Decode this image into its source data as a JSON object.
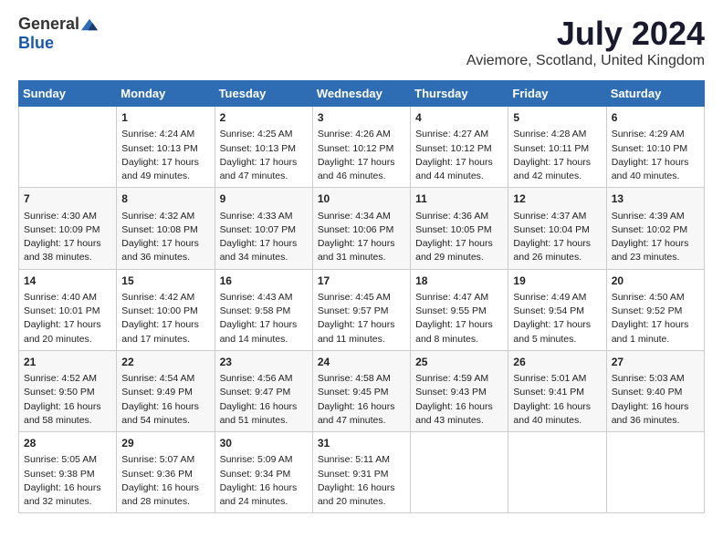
{
  "header": {
    "logo_general": "General",
    "logo_blue": "Blue",
    "month_title": "July 2024",
    "location": "Aviemore, Scotland, United Kingdom"
  },
  "weekdays": [
    "Sunday",
    "Monday",
    "Tuesday",
    "Wednesday",
    "Thursday",
    "Friday",
    "Saturday"
  ],
  "weeks": [
    [
      {
        "day": "",
        "content": ""
      },
      {
        "day": "1",
        "content": "Sunrise: 4:24 AM\nSunset: 10:13 PM\nDaylight: 17 hours\nand 49 minutes."
      },
      {
        "day": "2",
        "content": "Sunrise: 4:25 AM\nSunset: 10:13 PM\nDaylight: 17 hours\nand 47 minutes."
      },
      {
        "day": "3",
        "content": "Sunrise: 4:26 AM\nSunset: 10:12 PM\nDaylight: 17 hours\nand 46 minutes."
      },
      {
        "day": "4",
        "content": "Sunrise: 4:27 AM\nSunset: 10:12 PM\nDaylight: 17 hours\nand 44 minutes."
      },
      {
        "day": "5",
        "content": "Sunrise: 4:28 AM\nSunset: 10:11 PM\nDaylight: 17 hours\nand 42 minutes."
      },
      {
        "day": "6",
        "content": "Sunrise: 4:29 AM\nSunset: 10:10 PM\nDaylight: 17 hours\nand 40 minutes."
      }
    ],
    [
      {
        "day": "7",
        "content": "Sunrise: 4:30 AM\nSunset: 10:09 PM\nDaylight: 17 hours\nand 38 minutes."
      },
      {
        "day": "8",
        "content": "Sunrise: 4:32 AM\nSunset: 10:08 PM\nDaylight: 17 hours\nand 36 minutes."
      },
      {
        "day": "9",
        "content": "Sunrise: 4:33 AM\nSunset: 10:07 PM\nDaylight: 17 hours\nand 34 minutes."
      },
      {
        "day": "10",
        "content": "Sunrise: 4:34 AM\nSunset: 10:06 PM\nDaylight: 17 hours\nand 31 minutes."
      },
      {
        "day": "11",
        "content": "Sunrise: 4:36 AM\nSunset: 10:05 PM\nDaylight: 17 hours\nand 29 minutes."
      },
      {
        "day": "12",
        "content": "Sunrise: 4:37 AM\nSunset: 10:04 PM\nDaylight: 17 hours\nand 26 minutes."
      },
      {
        "day": "13",
        "content": "Sunrise: 4:39 AM\nSunset: 10:02 PM\nDaylight: 17 hours\nand 23 minutes."
      }
    ],
    [
      {
        "day": "14",
        "content": "Sunrise: 4:40 AM\nSunset: 10:01 PM\nDaylight: 17 hours\nand 20 minutes."
      },
      {
        "day": "15",
        "content": "Sunrise: 4:42 AM\nSunset: 10:00 PM\nDaylight: 17 hours\nand 17 minutes."
      },
      {
        "day": "16",
        "content": "Sunrise: 4:43 AM\nSunset: 9:58 PM\nDaylight: 17 hours\nand 14 minutes."
      },
      {
        "day": "17",
        "content": "Sunrise: 4:45 AM\nSunset: 9:57 PM\nDaylight: 17 hours\nand 11 minutes."
      },
      {
        "day": "18",
        "content": "Sunrise: 4:47 AM\nSunset: 9:55 PM\nDaylight: 17 hours\nand 8 minutes."
      },
      {
        "day": "19",
        "content": "Sunrise: 4:49 AM\nSunset: 9:54 PM\nDaylight: 17 hours\nand 5 minutes."
      },
      {
        "day": "20",
        "content": "Sunrise: 4:50 AM\nSunset: 9:52 PM\nDaylight: 17 hours\nand 1 minute."
      }
    ],
    [
      {
        "day": "21",
        "content": "Sunrise: 4:52 AM\nSunset: 9:50 PM\nDaylight: 16 hours\nand 58 minutes."
      },
      {
        "day": "22",
        "content": "Sunrise: 4:54 AM\nSunset: 9:49 PM\nDaylight: 16 hours\nand 54 minutes."
      },
      {
        "day": "23",
        "content": "Sunrise: 4:56 AM\nSunset: 9:47 PM\nDaylight: 16 hours\nand 51 minutes."
      },
      {
        "day": "24",
        "content": "Sunrise: 4:58 AM\nSunset: 9:45 PM\nDaylight: 16 hours\nand 47 minutes."
      },
      {
        "day": "25",
        "content": "Sunrise: 4:59 AM\nSunset: 9:43 PM\nDaylight: 16 hours\nand 43 minutes."
      },
      {
        "day": "26",
        "content": "Sunrise: 5:01 AM\nSunset: 9:41 PM\nDaylight: 16 hours\nand 40 minutes."
      },
      {
        "day": "27",
        "content": "Sunrise: 5:03 AM\nSunset: 9:40 PM\nDaylight: 16 hours\nand 36 minutes."
      }
    ],
    [
      {
        "day": "28",
        "content": "Sunrise: 5:05 AM\nSunset: 9:38 PM\nDaylight: 16 hours\nand 32 minutes."
      },
      {
        "day": "29",
        "content": "Sunrise: 5:07 AM\nSunset: 9:36 PM\nDaylight: 16 hours\nand 28 minutes."
      },
      {
        "day": "30",
        "content": "Sunrise: 5:09 AM\nSunset: 9:34 PM\nDaylight: 16 hours\nand 24 minutes."
      },
      {
        "day": "31",
        "content": "Sunrise: 5:11 AM\nSunset: 9:31 PM\nDaylight: 16 hours\nand 20 minutes."
      },
      {
        "day": "",
        "content": ""
      },
      {
        "day": "",
        "content": ""
      },
      {
        "day": "",
        "content": ""
      }
    ]
  ]
}
